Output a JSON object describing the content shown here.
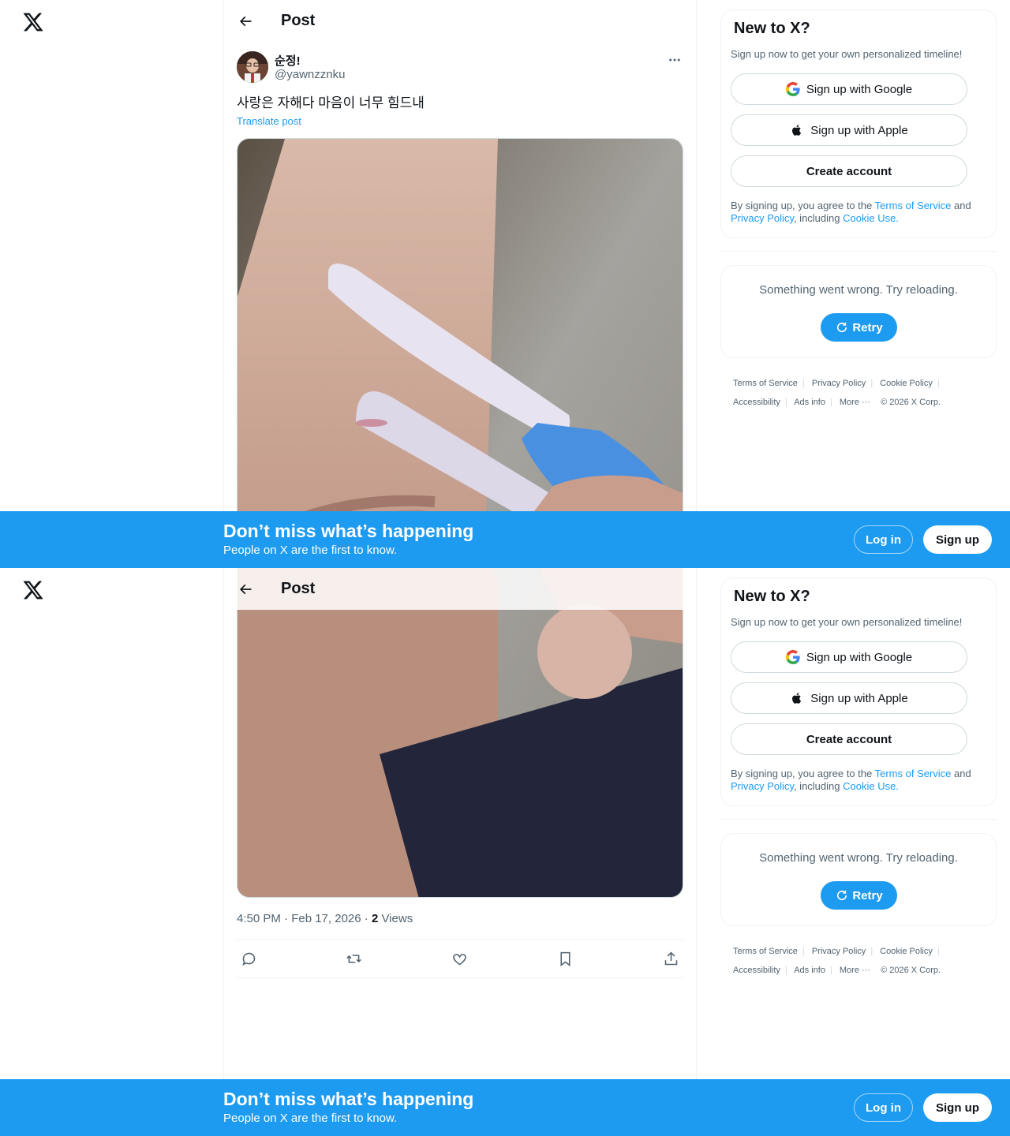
{
  "header": {
    "title": "Post"
  },
  "post": {
    "display_name": "순정!",
    "handle": "@yawnzznku",
    "text": "사랑은 자해다 마음이 너무 힘드내",
    "translate_label": "Translate post",
    "timestamp": "4:50 PM · Feb 17, 2026 · ",
    "views_count": "2",
    "views_label": " Views"
  },
  "icons": [
    "x-logo-icon",
    "back-arrow-icon",
    "more-icon",
    "reply-icon",
    "repost-icon",
    "like-icon",
    "bookmark-icon",
    "share-icon",
    "google-icon",
    "apple-icon",
    "retry-icon"
  ],
  "signup_card": {
    "title": "New to X?",
    "subtitle": "Sign up now to get your own personalized timeline!",
    "google_label": "Sign up with Google",
    "apple_label": "Sign up with Apple",
    "create_label": "Create account",
    "legal_prefix": "By signing up, you agree to the ",
    "terms_link": "Terms of Service",
    "legal_and": " and ",
    "privacy_link": "Privacy Policy",
    "legal_including": ", including ",
    "cookie_link": "Cookie Use."
  },
  "error_card": {
    "message": "Something went wrong. Try reloading.",
    "retry_label": "Retry"
  },
  "footer": {
    "terms": "Terms of Service",
    "privacy": "Privacy Policy",
    "cookie": "Cookie Policy",
    "accessibility": "Accessibility",
    "ads": "Ads info",
    "more": "More ···",
    "copyright": "© 2026 X Corp."
  },
  "banner": {
    "title": "Don’t miss what’s happening",
    "subtitle": "People on X are the first to know.",
    "login_label": "Log in",
    "signup_label": "Sign up"
  },
  "colors": {
    "accent": "#1d9bf0",
    "text": "#0f1419",
    "muted": "#536471",
    "border": "#eff3f4"
  }
}
